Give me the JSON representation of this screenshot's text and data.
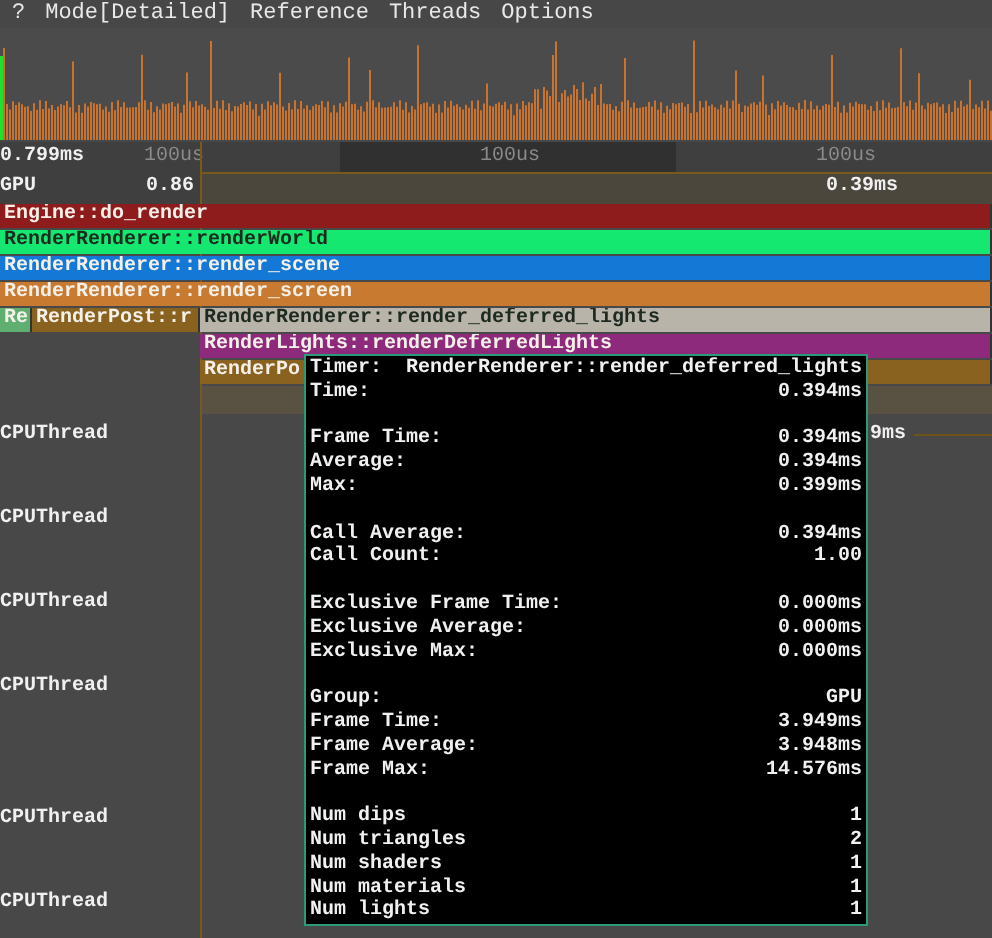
{
  "menu": [
    {
      "label": "?"
    },
    {
      "label": "Mode[Detailed]"
    },
    {
      "label": "Reference"
    },
    {
      "label": "Threads"
    },
    {
      "label": "Options"
    }
  ],
  "ruler": {
    "reading": "0.799ms",
    "ticks": [
      "100us",
      "100us",
      "100us"
    ]
  },
  "gpu_row": {
    "label": "GPU",
    "value": "0.86",
    "reading": "0.39ms"
  },
  "timeline_rows": [
    [
      {
        "label": "Engine::do_render",
        "color": "#8e1c1c"
      }
    ],
    [
      {
        "label": "RenderRenderer::renderWorld",
        "color": "#14e870"
      }
    ],
    [
      {
        "label": "RenderRenderer::render_scene",
        "color": "#1479d6"
      }
    ],
    [
      {
        "label": "RenderRenderer::render_screen",
        "color": "#c77a30"
      }
    ],
    [
      {
        "label": "Re",
        "color": "#5fb070"
      },
      {
        "label": "RenderPost::r",
        "color": "#8a6220"
      },
      {
        "label": "RenderRenderer::render_deferred_lights",
        "color": "#b8b4aa"
      }
    ],
    [
      {
        "label": "RenderLights::renderDeferredLights",
        "color": "#8e2a7c"
      }
    ],
    [
      {
        "label": "RenderPo",
        "color": "#8a6220"
      }
    ]
  ],
  "hidden_reading": "9ms",
  "cpu_threads": [
    "CPUThread",
    "CPUThread",
    "CPUThread",
    "CPUThread",
    "CPUThread",
    "CPUThread"
  ],
  "tooltip": {
    "sections": [
      [
        {
          "label": "Timer:",
          "value": "RenderRenderer::render_deferred_lights"
        },
        {
          "label": "Time:",
          "value": "0.394ms"
        }
      ],
      [
        {
          "label": "Frame Time:",
          "value": "0.394ms"
        },
        {
          "label": "Average:",
          "value": "0.394ms"
        },
        {
          "label": "Max:",
          "value": "0.399ms"
        }
      ],
      [
        {
          "label": "Call Average:",
          "value": "0.394ms"
        },
        {
          "label": "Call Count:",
          "value": "1.00"
        }
      ],
      [
        {
          "label": "Exclusive Frame Time:",
          "value": "0.000ms"
        },
        {
          "label": "Exclusive Average:",
          "value": "0.000ms"
        },
        {
          "label": "Exclusive Max:",
          "value": "0.000ms"
        }
      ],
      [
        {
          "label": "Group:",
          "value": "GPU"
        },
        {
          "label": "Frame Time:",
          "value": "3.949ms"
        },
        {
          "label": "Frame Average:",
          "value": "3.948ms"
        },
        {
          "label": "Frame Max:",
          "value": "14.576ms"
        }
      ],
      [
        {
          "label": "Num dips",
          "value": "1"
        },
        {
          "label": "Num triangles",
          "value": "2"
        },
        {
          "label": "Num shaders",
          "value": "1"
        },
        {
          "label": "Num materials",
          "value": "1"
        },
        {
          "label": "Num lights",
          "value": "1"
        }
      ]
    ]
  }
}
